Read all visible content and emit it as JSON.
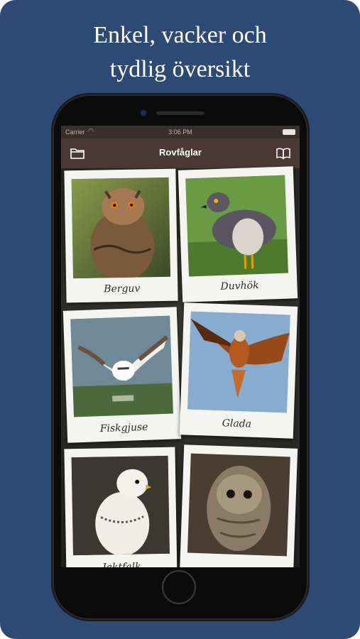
{
  "headline": {
    "line1": "Enkel, vacker och",
    "line2": "tydlig översikt"
  },
  "status": {
    "carrier": "Carrier",
    "time": "3:06 PM"
  },
  "nav": {
    "title": "Rovfåglar"
  },
  "cards": [
    {
      "label": "Berguv"
    },
    {
      "label": "Duvhök"
    },
    {
      "label": "Fiskgjuse"
    },
    {
      "label": "Glada"
    },
    {
      "label": "Jaktfalk"
    },
    {
      "label": ""
    }
  ]
}
